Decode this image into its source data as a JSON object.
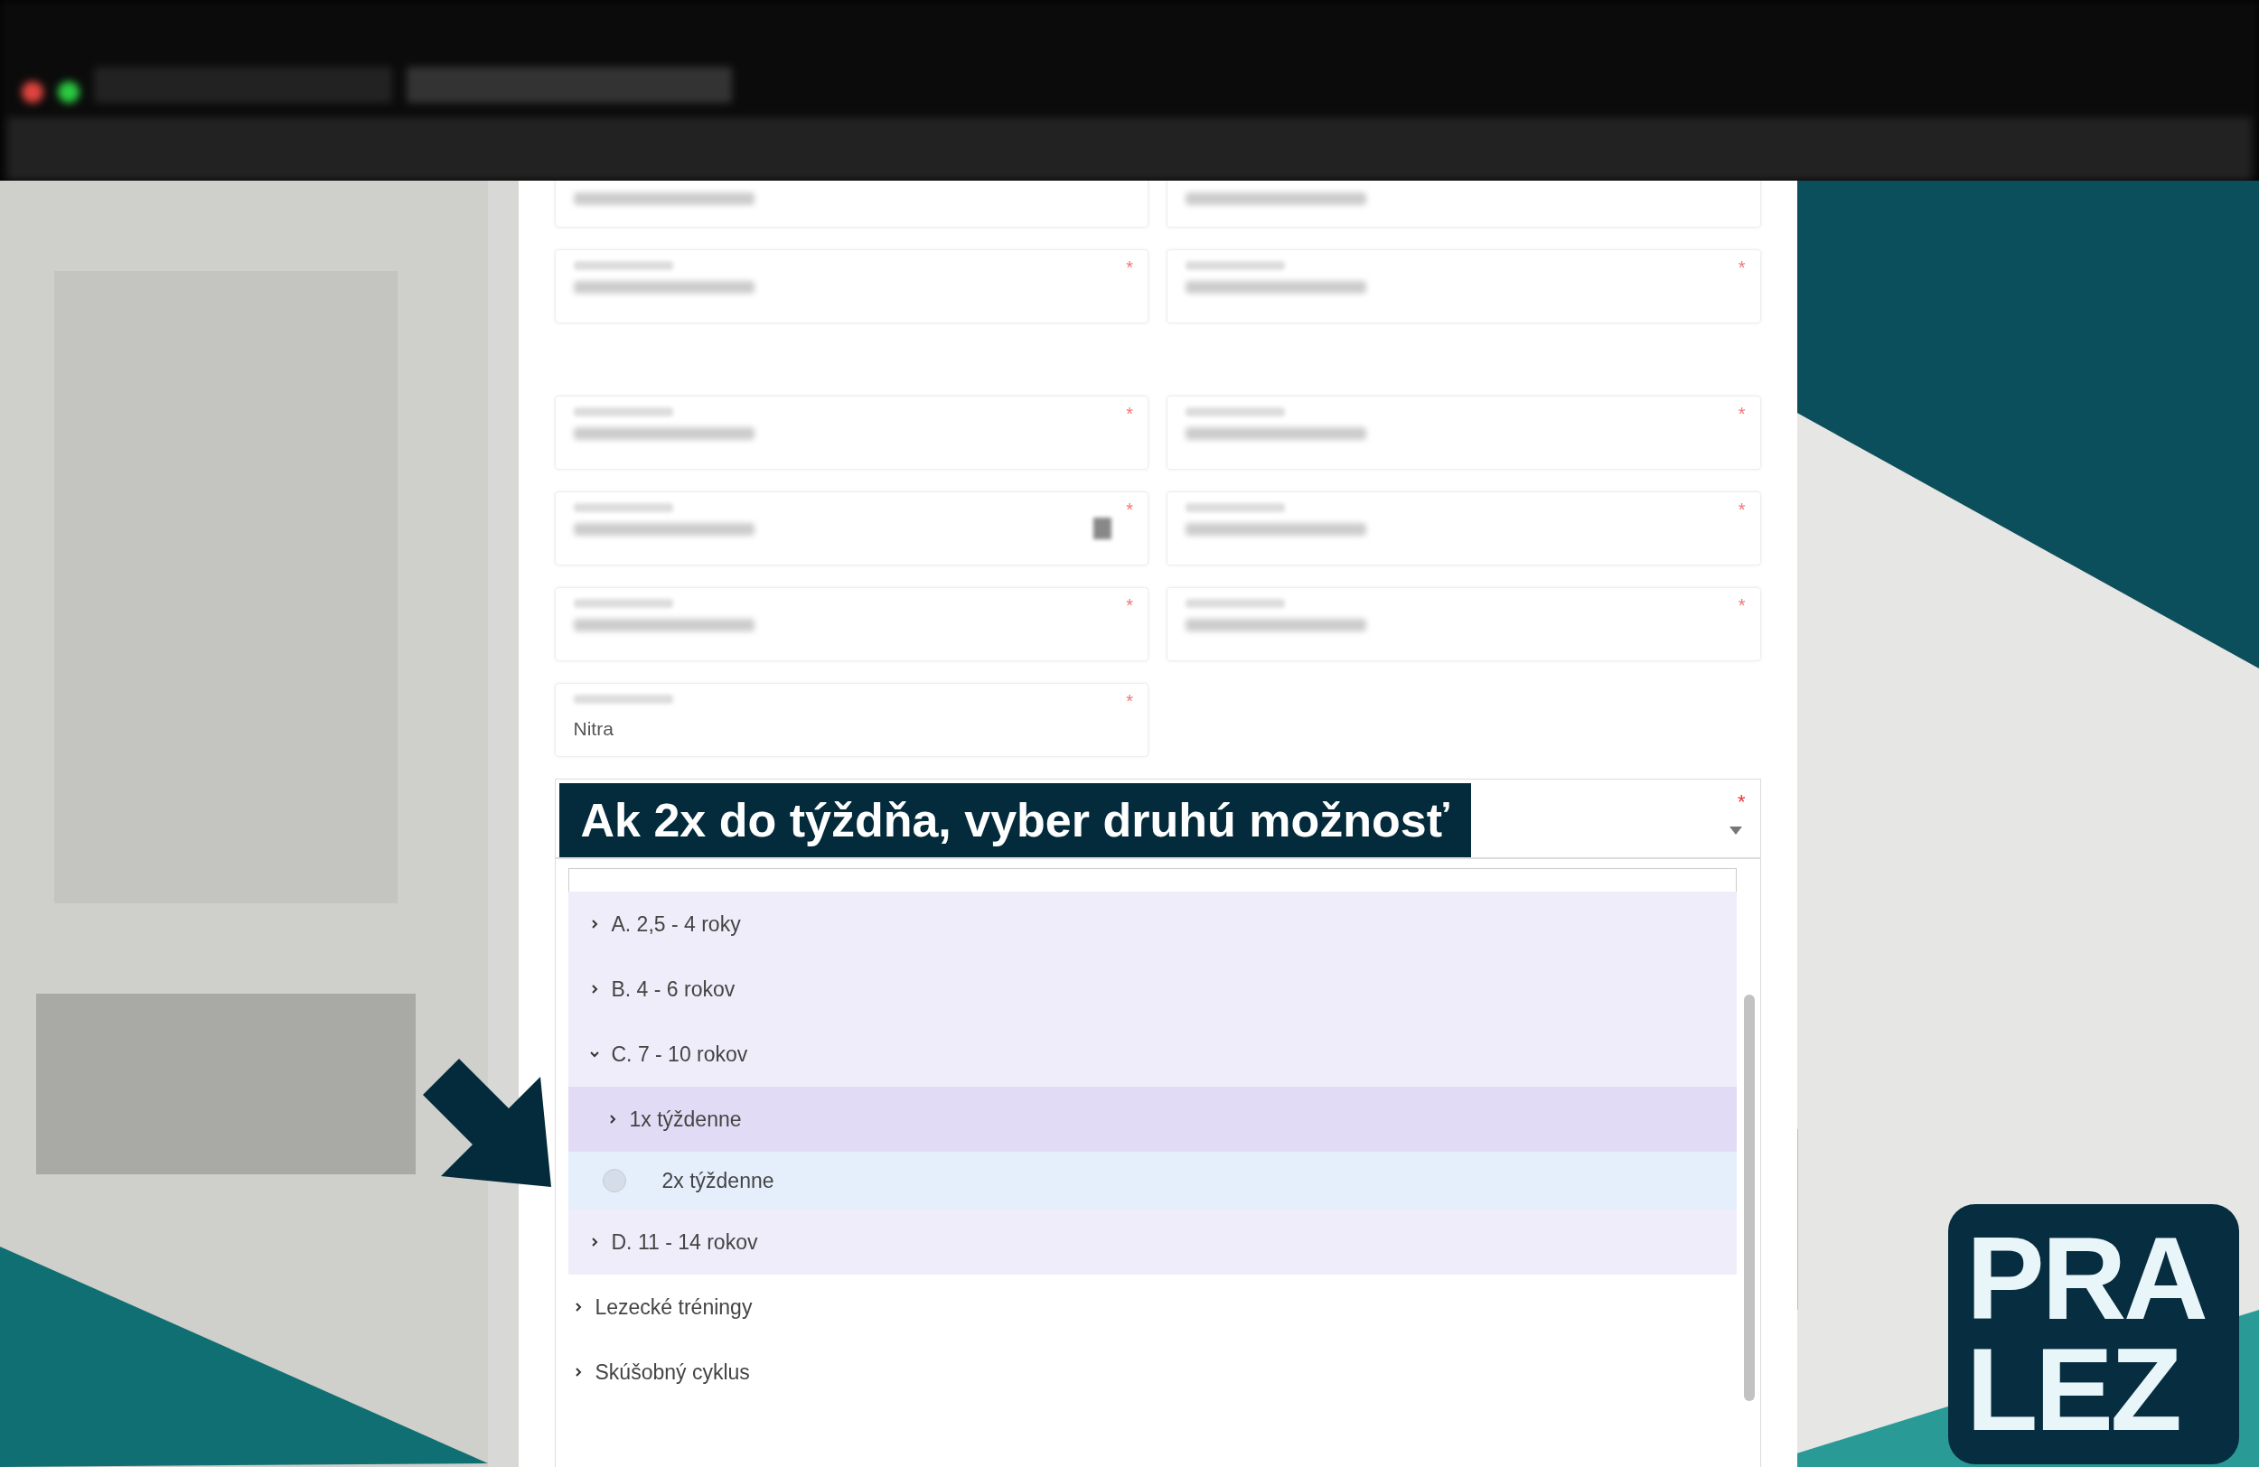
{
  "form": {
    "rows_above": [
      [
        {
          "kind": "cut"
        },
        {
          "kind": "cut"
        }
      ],
      [
        {
          "kind": "blurred",
          "required_mark": "*"
        },
        {
          "kind": "blurred",
          "required_mark": "*"
        }
      ]
    ],
    "rows": [
      [
        {
          "kind": "blurred",
          "required_mark": "*"
        },
        {
          "kind": "blurred",
          "required_mark": "*"
        }
      ],
      [
        {
          "kind": "date",
          "required_mark": "*"
        },
        {
          "kind": "blurred",
          "required_mark": "*"
        }
      ],
      [
        {
          "kind": "blurred",
          "required_mark": "*"
        },
        {
          "kind": "blurred",
          "required_mark": "*"
        }
      ],
      [
        {
          "kind": "text",
          "value": "Nitra",
          "required_mark": "*"
        }
      ]
    ]
  },
  "select": {
    "required_mark": "*",
    "expanded": true,
    "nested_options": [
      {
        "label": "A. 2,5 - 4 roky",
        "expanded": false
      },
      {
        "label": "B. 4 - 6 rokov",
        "expanded": false
      },
      {
        "label": "C. 7 - 10 rokov",
        "expanded": true,
        "children": [
          {
            "kind": "branch",
            "label": "1x týždenne",
            "expanded": false,
            "highlighted": true
          },
          {
            "kind": "leaf",
            "label": "2x týždenne",
            "selected": false,
            "highlighted": false
          }
        ]
      },
      {
        "label": "D. 11 - 14 rokov",
        "expanded": false
      }
    ],
    "options": [
      {
        "label": "Lezecké tréningy",
        "expanded": false
      },
      {
        "label": "Skúšobný cyklus",
        "expanded": false
      }
    ]
  },
  "annotation": {
    "text": "Ak 2x do týždňa, vyber druhú možnosť"
  },
  "logo": {
    "lines": [
      "PRA",
      "LEZ"
    ]
  }
}
